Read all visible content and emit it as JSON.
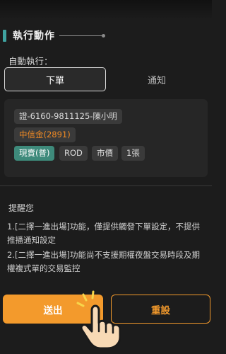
{
  "section": {
    "title": "執行動作"
  },
  "auto_exec": {
    "label": "自動執行：",
    "options": [
      {
        "label": "下單",
        "selected": true
      },
      {
        "label": "通知",
        "selected": false
      }
    ]
  },
  "order_card": {
    "account": "證-6160-9811125-陳小明",
    "broker": "中信金(2891)",
    "tags": [
      "現賣(普)",
      "ROD",
      "市價",
      "1張"
    ]
  },
  "reminder": {
    "title": "提醒您",
    "notes": [
      "1.[二擇一進出場]功能，僅提供觸發下單設定，不提供推播通知設定",
      "2.[二擇一進出場]功能尚不支援期權夜盤交易時段及期權複式單的交易監控"
    ]
  },
  "actions": {
    "submit_label": "送出",
    "reset_label": "重設"
  },
  "colors": {
    "accent_orange": "#f39a2c",
    "section_bar_teal": "#3fa3a0",
    "tag_green": "#3e8a7b",
    "background": "#1c1c1c"
  },
  "icons": [
    "tap-hand-icon"
  ]
}
